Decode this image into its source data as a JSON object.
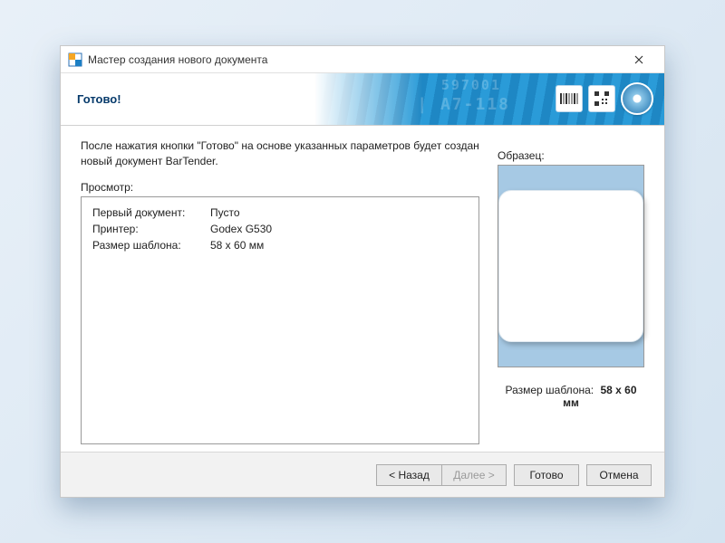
{
  "window": {
    "title": "Мастер создания нового документа"
  },
  "banner": {
    "heading": "Готово!"
  },
  "intro": {
    "text": "После нажатия кнопки \"Готово\" на основе указанных параметров будет создан новый документ BarTender."
  },
  "preview": {
    "label": "Просмотр:",
    "rows": {
      "first_doc_label": "Первый документ:",
      "first_doc_value": "Пусто",
      "printer_label": "Принтер:",
      "printer_value": "Godex G530",
      "tpl_size_label": "Размер шаблона:",
      "tpl_size_value": "58 x 60 мм"
    }
  },
  "sample": {
    "label": "Образец:",
    "size_label": "Размер шаблона:",
    "size_value": "58 x 60 мм"
  },
  "buttons": {
    "back": "<  Назад",
    "next": "Далее  >",
    "finish": "Готово",
    "cancel": "Отмена"
  }
}
